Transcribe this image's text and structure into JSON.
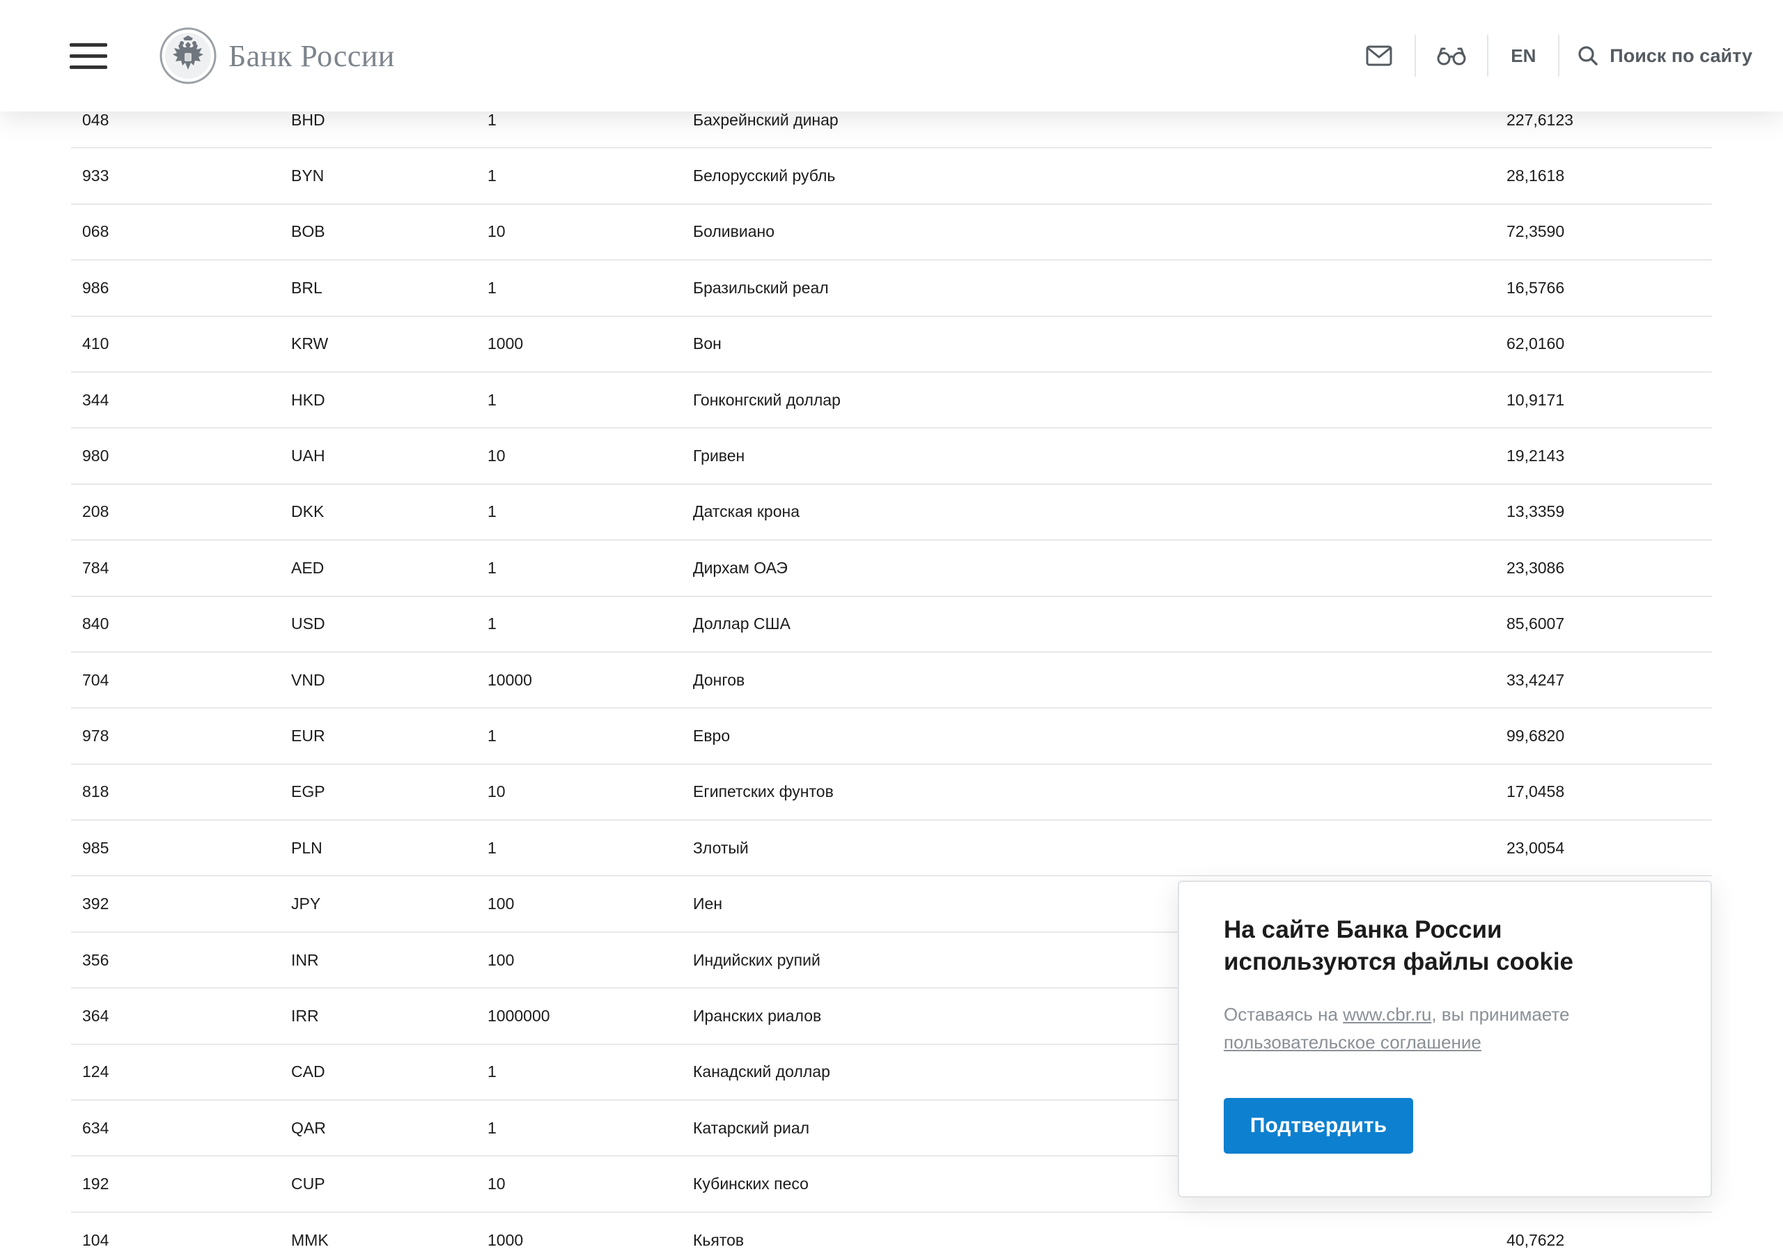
{
  "header": {
    "logo_text": "Банк России",
    "lang_label": "EN",
    "search_label": "Поиск по сайту"
  },
  "table": {
    "rows": [
      {
        "code": "048",
        "char": "BHD",
        "unit": "1",
        "name": "Бахрейнский динар",
        "rate": "227,6123"
      },
      {
        "code": "933",
        "char": "BYN",
        "unit": "1",
        "name": "Белорусский рубль",
        "rate": "28,1618"
      },
      {
        "code": "068",
        "char": "BOB",
        "unit": "10",
        "name": "Боливиано",
        "rate": "72,3590"
      },
      {
        "code": "986",
        "char": "BRL",
        "unit": "1",
        "name": "Бразильский реал",
        "rate": "16,5766"
      },
      {
        "code": "410",
        "char": "KRW",
        "unit": "1000",
        "name": "Вон",
        "rate": "62,0160"
      },
      {
        "code": "344",
        "char": "HKD",
        "unit": "1",
        "name": "Гонконгский доллар",
        "rate": "10,9171"
      },
      {
        "code": "980",
        "char": "UAH",
        "unit": "10",
        "name": "Гривен",
        "rate": "19,2143"
      },
      {
        "code": "208",
        "char": "DKK",
        "unit": "1",
        "name": "Датская крона",
        "rate": "13,3359"
      },
      {
        "code": "784",
        "char": "AED",
        "unit": "1",
        "name": "Дирхам ОАЭ",
        "rate": "23,3086"
      },
      {
        "code": "840",
        "char": "USD",
        "unit": "1",
        "name": "Доллар США",
        "rate": "85,6007"
      },
      {
        "code": "704",
        "char": "VND",
        "unit": "10000",
        "name": "Донгов",
        "rate": "33,4247"
      },
      {
        "code": "978",
        "char": "EUR",
        "unit": "1",
        "name": "Евро",
        "rate": "99,6820"
      },
      {
        "code": "818",
        "char": "EGP",
        "unit": "10",
        "name": "Египетских фунтов",
        "rate": "17,0458"
      },
      {
        "code": "985",
        "char": "PLN",
        "unit": "1",
        "name": "Злотый",
        "rate": "23,0054"
      },
      {
        "code": "392",
        "char": "JPY",
        "unit": "100",
        "name": "Иен",
        "rate": ""
      },
      {
        "code": "356",
        "char": "INR",
        "unit": "100",
        "name": "Индийских рупий",
        "rate": ""
      },
      {
        "code": "364",
        "char": "IRR",
        "unit": "1000000",
        "name": "Иранских риалов",
        "rate": ""
      },
      {
        "code": "124",
        "char": "CAD",
        "unit": "1",
        "name": "Канадский доллар",
        "rate": ""
      },
      {
        "code": "634",
        "char": "QAR",
        "unit": "1",
        "name": "Катарский риал",
        "rate": ""
      },
      {
        "code": "192",
        "char": "CUP",
        "unit": "10",
        "name": "Кубинских песо",
        "rate": ""
      },
      {
        "code": "104",
        "char": "MMK",
        "unit": "1000",
        "name": "Кьятов",
        "rate": "40,7622"
      }
    ]
  },
  "cookie": {
    "title": "На сайте Банка России используются файлы cookie",
    "text_prefix": "Оставаясь на ",
    "site_link": "www.cbr.ru",
    "text_middle": ", вы принимаете ",
    "agreement_link": "пользовательское соглашение",
    "confirm_label": "Подтвердить"
  },
  "colors": {
    "accent": "#0d80d0",
    "text": "#1c1c1c",
    "muted": "#8a9096",
    "divider": "#e6e8ea"
  },
  "icons": {
    "menu": "hamburger-menu-icon",
    "logo": "double-headed-eagle-emblem",
    "mail": "mail-icon",
    "accessibility": "glasses-icon",
    "search": "search-icon"
  }
}
